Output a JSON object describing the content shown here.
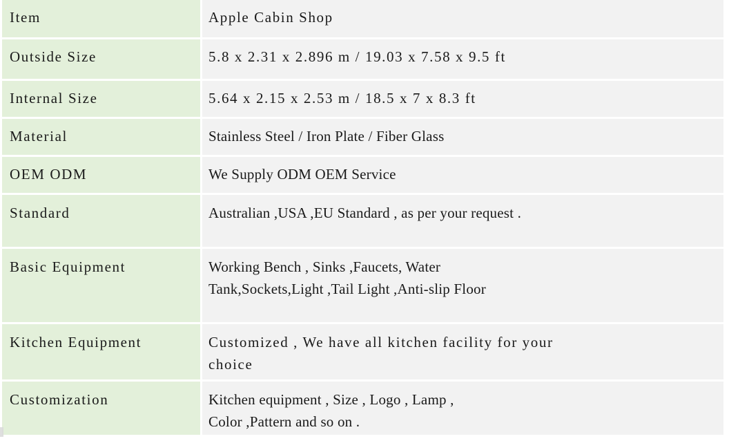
{
  "table": {
    "colors": {
      "label_cell_background": "#e3f0da",
      "value_cell_background": "#f2f2f2",
      "page_background": "#ffffff",
      "text": "#1a1a1a"
    },
    "columns": [
      "Item",
      "Apple Cabin Shop"
    ],
    "rows": [
      {
        "label": "Item",
        "value": "Apple Cabin Shop"
      },
      {
        "label": "Outside Size",
        "value": "5.8 x 2.31 x 2.896 m / 19.03 x 7.58 x 9.5 ft"
      },
      {
        "label": "Internal Size",
        "value": "5.64 x 2.15 x 2.53 m / 18.5 x 7 x 8.3 ft"
      },
      {
        "label": "Material",
        "value": "Stainless Steel / Iron Plate / Fiber Glass"
      },
      {
        "label": "OEM ODM",
        "value": "We Supply ODM OEM Service"
      },
      {
        "label": "Standard",
        "value": "Australian ,USA ,EU Standard , as per your request ."
      },
      {
        "label": "Basic Equipment",
        "value": "Working Bench , Sinks ,Faucets, Water\nTank,Sockets,Light ,Tail Light ,Anti-slip Floor"
      },
      {
        "label": "Kitchen Equipment",
        "value": "Customized , We have all kitchen facility for your\nchoice"
      },
      {
        "label": "Customization",
        "value": "Kitchen equipment , Size , Logo , Lamp ,\nColor ,Pattern and so on ."
      }
    ]
  }
}
